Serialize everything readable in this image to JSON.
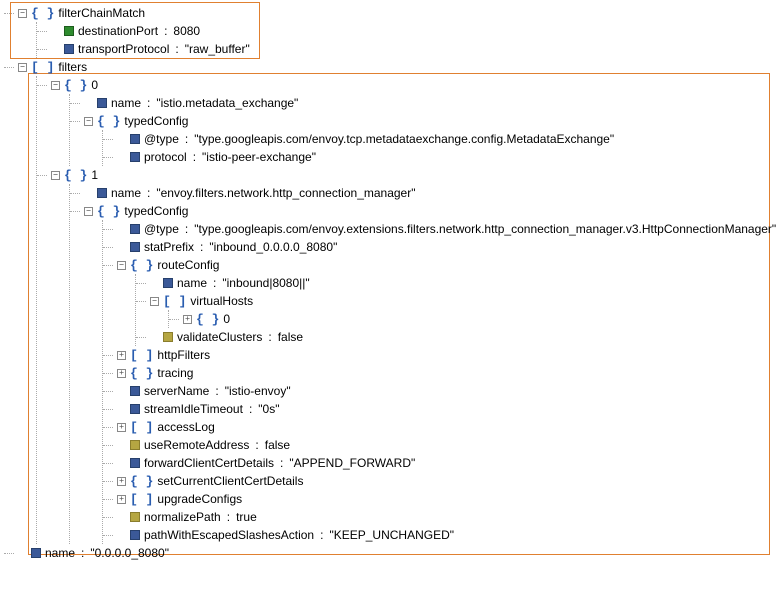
{
  "tree": {
    "filterChainMatch": {
      "label": "filterChainMatch",
      "destinationPort": {
        "key": "destinationPort",
        "value": "8080"
      },
      "transportProtocol": {
        "key": "transportProtocol",
        "value": "\"raw_buffer\""
      }
    },
    "filters": {
      "label": "filters",
      "item0": {
        "index": "0",
        "name": {
          "key": "name",
          "value": "\"istio.metadata_exchange\""
        },
        "typedConfig": {
          "label": "typedConfig",
          "atType": {
            "key": "@type",
            "value": "\"type.googleapis.com/envoy.tcp.metadataexchange.config.MetadataExchange\""
          },
          "protocol": {
            "key": "protocol",
            "value": "\"istio-peer-exchange\""
          }
        }
      },
      "item1": {
        "index": "1",
        "name": {
          "key": "name",
          "value": "\"envoy.filters.network.http_connection_manager\""
        },
        "typedConfig": {
          "label": "typedConfig",
          "atType": {
            "key": "@type",
            "value": "\"type.googleapis.com/envoy.extensions.filters.network.http_connection_manager.v3.HttpConnectionManager\""
          },
          "statPrefix": {
            "key": "statPrefix",
            "value": "\"inbound_0.0.0.0_8080\""
          },
          "routeConfig": {
            "label": "routeConfig",
            "name": {
              "key": "name",
              "value": "\"inbound|8080||\""
            },
            "virtualHosts": {
              "label": "virtualHosts",
              "item0": {
                "index": "0"
              }
            },
            "validateClusters": {
              "key": "validateClusters",
              "value": "false"
            }
          },
          "httpFilters": {
            "label": "httpFilters"
          },
          "tracing": {
            "label": "tracing"
          },
          "serverName": {
            "key": "serverName",
            "value": "\"istio-envoy\""
          },
          "streamIdleTimeout": {
            "key": "streamIdleTimeout",
            "value": "\"0s\""
          },
          "accessLog": {
            "label": "accessLog"
          },
          "useRemoteAddress": {
            "key": "useRemoteAddress",
            "value": "false"
          },
          "forwardClientCertDetails": {
            "key": "forwardClientCertDetails",
            "value": "\"APPEND_FORWARD\""
          },
          "setCurrentClientCertDetails": {
            "label": "setCurrentClientCertDetails"
          },
          "upgradeConfigs": {
            "label": "upgradeConfigs"
          },
          "normalizePath": {
            "key": "normalizePath",
            "value": "true"
          },
          "pathWithEscapedSlashesAction": {
            "key": "pathWithEscapedSlashesAction",
            "value": "\"KEEP_UNCHANGED\""
          }
        }
      }
    },
    "bottomName": {
      "key": "name",
      "value": "\"0.0.0.0_8080\""
    }
  },
  "glyph": {
    "minus": "−",
    "plus": "+"
  }
}
